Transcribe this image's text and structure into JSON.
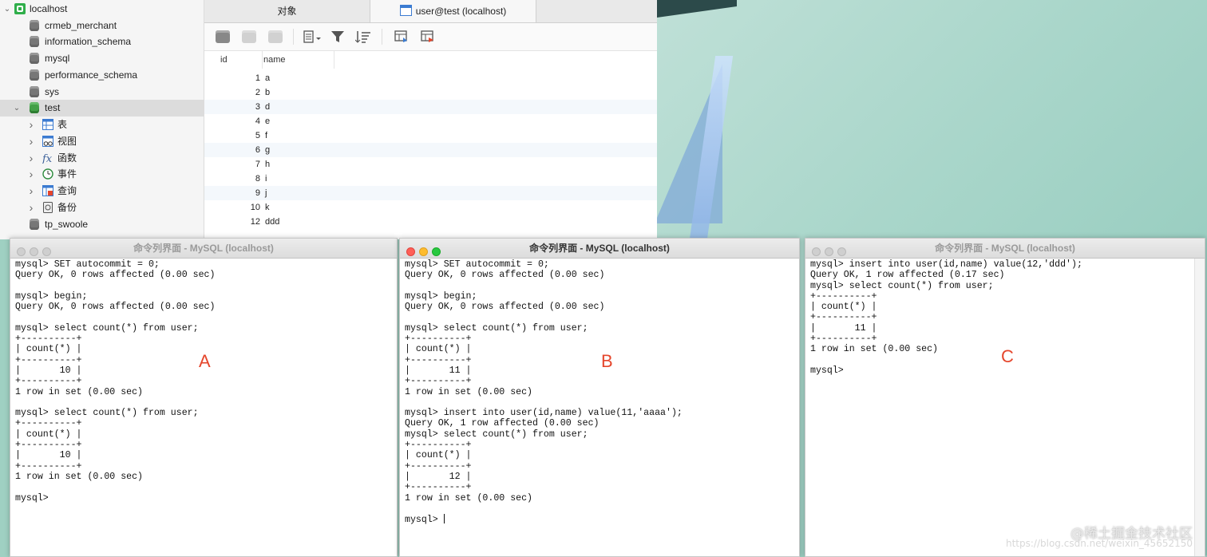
{
  "navicat": {
    "tree": [
      {
        "label": "localhost",
        "icon": "connection-icon",
        "expanded": true
      },
      {
        "label": "crmeb_merchant",
        "icon": "database-icon"
      },
      {
        "label": "information_schema",
        "icon": "database-icon"
      },
      {
        "label": "mysql",
        "icon": "database-icon"
      },
      {
        "label": "performance_schema",
        "icon": "database-icon"
      },
      {
        "label": "sys",
        "icon": "database-icon"
      },
      {
        "label": "test",
        "icon": "database-icon",
        "expanded": true,
        "selected": true
      },
      {
        "label": "表",
        "icon": "table-icon"
      },
      {
        "label": "视图",
        "icon": "view-icon"
      },
      {
        "label": "函数",
        "icon": "function-icon"
      },
      {
        "label": "事件",
        "icon": "event-icon"
      },
      {
        "label": "查询",
        "icon": "query-icon"
      },
      {
        "label": "备份",
        "icon": "backup-icon"
      },
      {
        "label": "tp_swoole",
        "icon": "database-icon"
      }
    ],
    "tabs": {
      "objects": "对象",
      "active": "user@test (localhost)"
    },
    "grid": {
      "columns": [
        "id",
        "name"
      ],
      "rows": [
        {
          "id": "1",
          "name": "a"
        },
        {
          "id": "2",
          "name": "b"
        },
        {
          "id": "3",
          "name": "d"
        },
        {
          "id": "4",
          "name": "e"
        },
        {
          "id": "5",
          "name": "f"
        },
        {
          "id": "6",
          "name": "g"
        },
        {
          "id": "7",
          "name": "h"
        },
        {
          "id": "8",
          "name": "i"
        },
        {
          "id": "9",
          "name": "j"
        },
        {
          "id": "10",
          "name": "k"
        },
        {
          "id": "12",
          "name": "ddd"
        }
      ]
    }
  },
  "terminals": [
    {
      "title": "命令列界面 - MySQL (localhost)",
      "marker": "A",
      "lines": [
        "mysql> SET autocommit = 0;",
        "Query OK, 0 rows affected (0.00 sec)",
        "",
        "mysql> begin;",
        "Query OK, 0 rows affected (0.00 sec)",
        "",
        "mysql> select count(*) from user;",
        "+----------+",
        "| count(*) |",
        "+----------+",
        "|       10 |",
        "+----------+",
        "1 row in set (0.00 sec)",
        "",
        "mysql> select count(*) from user;",
        "+----------+",
        "| count(*) |",
        "+----------+",
        "|       10 |",
        "+----------+",
        "1 row in set (0.00 sec)",
        "",
        "mysql>"
      ]
    },
    {
      "title": "命令列界面 - MySQL (localhost)",
      "marker": "B",
      "lines": [
        "mysql> SET autocommit = 0;",
        "Query OK, 0 rows affected (0.00 sec)",
        "",
        "mysql> begin;",
        "Query OK, 0 rows affected (0.00 sec)",
        "",
        "mysql> select count(*) from user;",
        "+----------+",
        "| count(*) |",
        "+----------+",
        "|       11 |",
        "+----------+",
        "1 row in set (0.00 sec)",
        "",
        "mysql> insert into user(id,name) value(11,'aaaa');",
        "Query OK, 1 row affected (0.00 sec)",
        "mysql> select count(*) from user;",
        "+----------+",
        "| count(*) |",
        "+----------+",
        "|       12 |",
        "+----------+",
        "1 row in set (0.00 sec)",
        "",
        "mysql> "
      ]
    },
    {
      "title": "命令列界面 - MySQL (localhost)",
      "marker": "C",
      "lines": [
        "mysql> insert into user(id,name) value(12,'ddd');",
        "Query OK, 1 row affected (0.17 sec)",
        "mysql> select count(*) from user;",
        "+----------+",
        "| count(*) |",
        "+----------+",
        "|       11 |",
        "+----------+",
        "1 row in set (0.00 sec)",
        "",
        "mysql>"
      ]
    }
  ],
  "watermark": {
    "brand": "@稀土掘金技术社区",
    "url": "https://blog.csdn.net/weixin_45652150"
  },
  "colors": {
    "marker": "#e5462c",
    "selection": "#dcdcdc",
    "accent": "#3b7bd1"
  }
}
